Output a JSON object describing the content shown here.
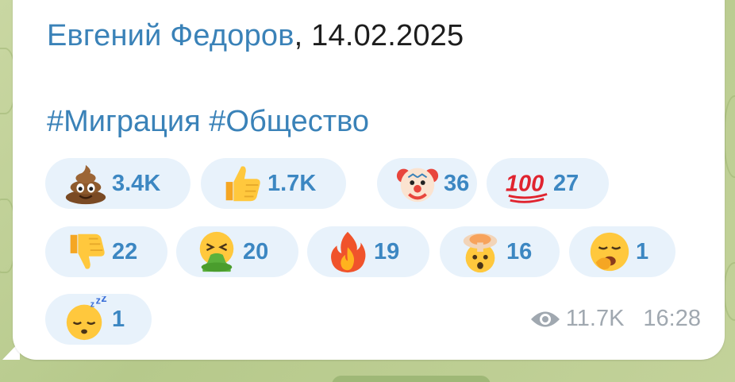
{
  "message": {
    "author_name": "Евгений Федоров",
    "author_separator": ", ",
    "author_date": "14.02.2025",
    "hashtags": [
      "#Миграция",
      "#Общество"
    ],
    "hashtag_color": "#3a82b8",
    "reaction_bg": "#e8f2fb",
    "reactions": [
      {
        "emoji": "pile-of-poo-emoji",
        "count": "3.4K"
      },
      {
        "emoji": "thumbs-up-emoji",
        "count": "1.7K"
      },
      {
        "emoji": "clown-face-emoji",
        "count": "36"
      },
      {
        "emoji": "hundred-points-emoji",
        "count": "27"
      },
      {
        "emoji": "thumbs-down-emoji",
        "count": "22"
      },
      {
        "emoji": "face-vomiting-emoji",
        "count": "20"
      },
      {
        "emoji": "fire-emoji",
        "count": "19"
      },
      {
        "emoji": "exploding-head-emoji",
        "count": "16"
      },
      {
        "emoji": "yawning-face-emoji",
        "count": "1"
      },
      {
        "emoji": "sleeping-face-emoji",
        "count": "1"
      }
    ],
    "views_icon": "eye-icon",
    "views": "11.7K",
    "time": "16:28"
  }
}
